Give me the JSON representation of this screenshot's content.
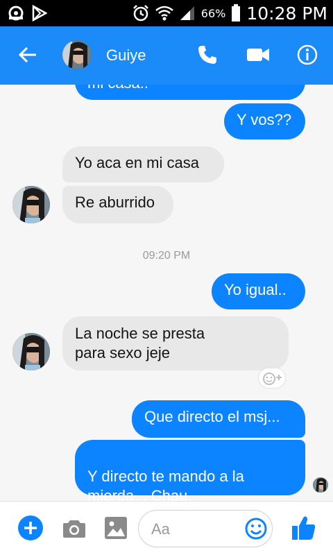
{
  "status_bar": {
    "battery": "66%",
    "time": "10:28 PM"
  },
  "header": {
    "contact_name": "Guiye"
  },
  "messages": [
    {
      "id": "m0",
      "direction": "outgoing",
      "text": "mi casa.."
    },
    {
      "id": "m1",
      "direction": "outgoing",
      "text": "Y vos??"
    },
    {
      "id": "m2",
      "direction": "incoming",
      "text": "Yo aca en mi casa"
    },
    {
      "id": "m3",
      "direction": "incoming",
      "text": "Re aburrido"
    },
    {
      "id": "m4",
      "direction": "outgoing",
      "text": "Yo igual.."
    },
    {
      "id": "m5",
      "direction": "incoming",
      "text": "La noche se presta\npara sexo jeje"
    },
    {
      "id": "m6",
      "direction": "outgoing",
      "text": "Que directo el msj..."
    },
    {
      "id": "m7",
      "direction": "outgoing",
      "text": "Y directo te mando a la\nmierda... Chau.",
      "emojis": "🙂😘"
    }
  ],
  "timestamp": "09:20 PM",
  "composer": {
    "placeholder": "Aa"
  },
  "colors": {
    "header_blue": "#1a8bf9",
    "outgoing_bubble": "#0d84ff",
    "incoming_bubble": "#e8e8e8"
  },
  "icons": {
    "back": "arrow-left-icon",
    "call": "phone-icon",
    "video": "video-camera-icon",
    "info": "info-icon",
    "add": "plus-icon",
    "camera": "camera-icon",
    "gallery": "image-icon",
    "emoji": "smiley-icon",
    "like": "thumbs-up-icon"
  }
}
